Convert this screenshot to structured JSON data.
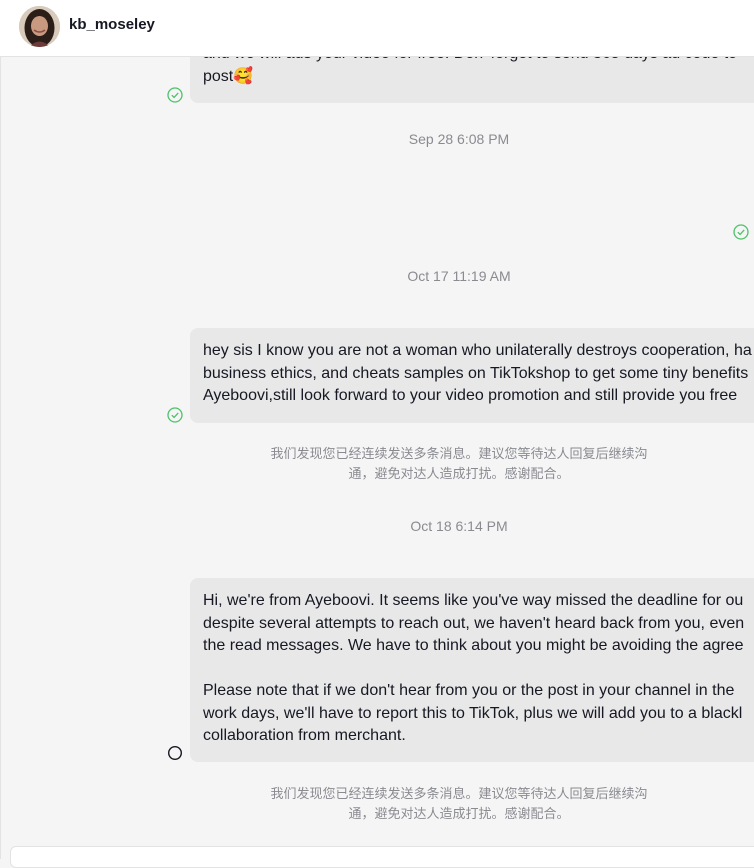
{
  "header": {
    "username": "kb_moseley",
    "avatar_icon": "user-avatar-photo"
  },
  "messages": [
    {
      "lines": [
        "and we will ads your video for free. Don' forget to send 365 days ad code to",
        "post🥰"
      ],
      "status": "read"
    },
    {
      "timestamp": "Sep 28 6:08 PM",
      "status": "read"
    },
    {
      "timestamp": "Oct 17 11:19 AM",
      "lines": [
        "hey sis I know you are not a woman who unilaterally destroys cooperation, ha",
        "business ethics, and cheats samples on TikTokshop to get some tiny benefits",
        "Ayeboovi,still look forward to your video promotion and still provide you free"
      ],
      "status": "read"
    },
    {
      "notice": [
        "我们发现您已经连续发送多条消息。建议您等待达人回复后继续沟",
        "通，避免对达人造成打扰。感谢配合。"
      ]
    },
    {
      "timestamp": "Oct 18 6:14 PM",
      "paragraph1": [
        "Hi, we're from Ayeboovi. It seems like you've way missed the deadline for ou",
        "despite several attempts to reach out, we haven't heard back from you, even",
        "the read messages. We have to think about you might be avoiding the agree"
      ],
      "paragraph2": [
        "Please note that if we don't hear from you or the post in your channel in the",
        "work days, we'll have to report this to TikTok, plus we will add you to a blackl",
        "collaboration from merchant."
      ],
      "status": "sent"
    },
    {
      "notice": [
        "我们发现您已经连续发送多条消息。建议您等待达人回复后继续沟",
        "通，避免对达人造成打扰。感谢配合。"
      ]
    }
  ],
  "colors": {
    "read_check": "#4fc16b",
    "bubble_bg": "#e8e8e8",
    "meta_text": "#8a8b91"
  }
}
